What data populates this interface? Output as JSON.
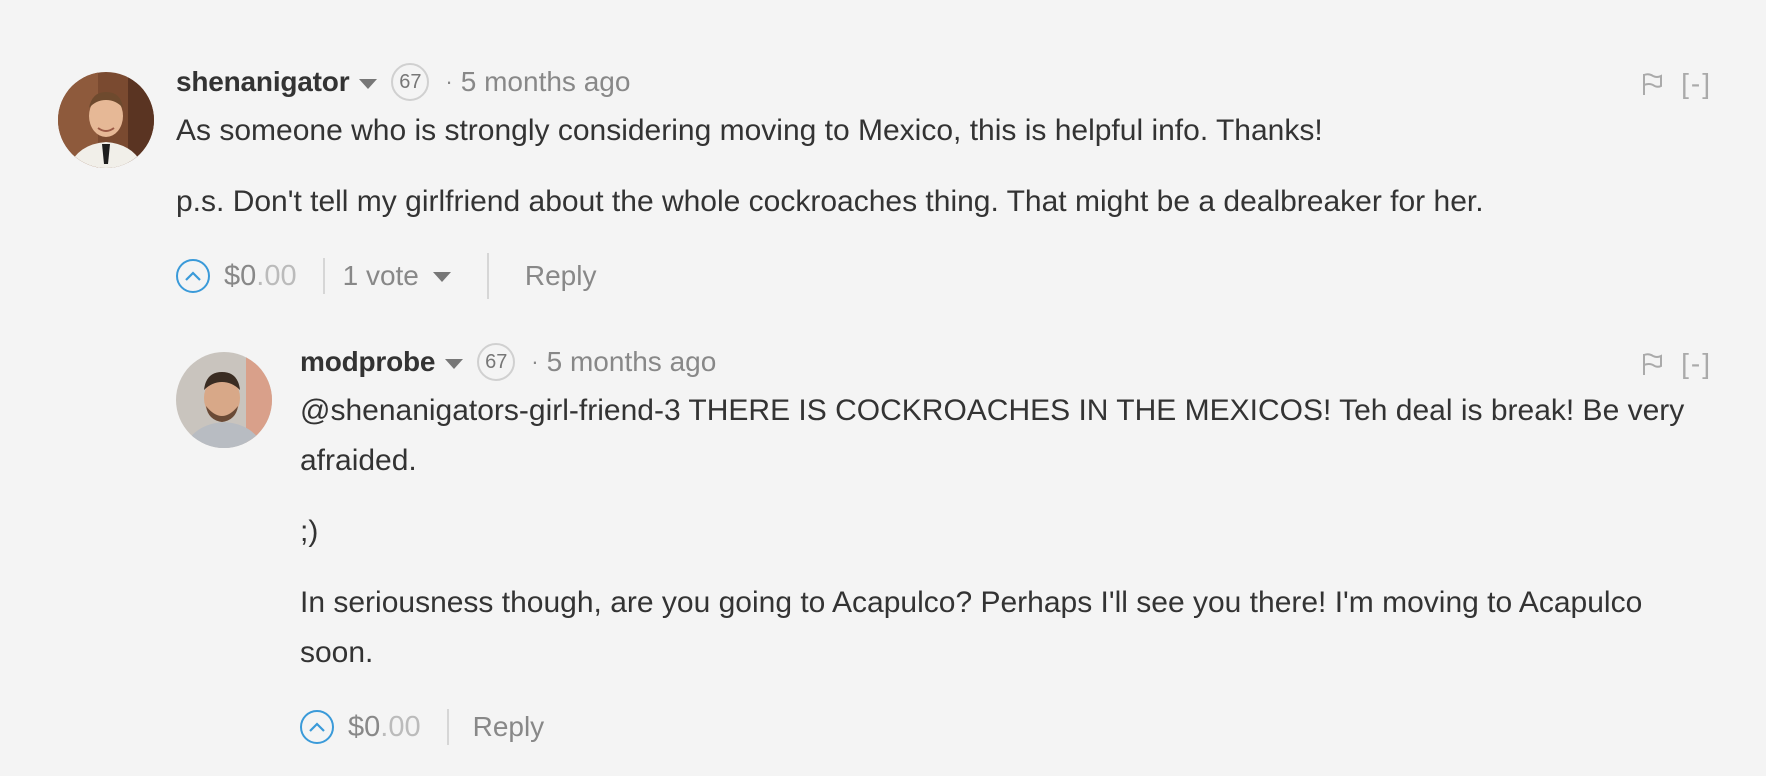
{
  "comments": [
    {
      "author": "shenanigator",
      "reputation": "67",
      "separator": "·",
      "timestamp": "5 months ago",
      "collapse_label": "[-]",
      "paragraphs": [
        "As someone who is strongly considering moving to Mexico, this is helpful info. Thanks!",
        "p.s. Don't tell my girlfriend about the whole cockroaches thing. That might be a dealbreaker for her."
      ],
      "payout_dollars": "$0",
      "payout_cents": ".00",
      "votes_label": "1 vote",
      "reply_label": "Reply"
    },
    {
      "author": "modprobe",
      "reputation": "67",
      "separator": "·",
      "timestamp": "5 months ago",
      "collapse_label": "[-]",
      "paragraphs": [
        "@shenanigators-girl-friend-3 THERE IS COCKROACHES IN THE MEXICOS! Teh deal is break! Be very afraided.",
        ";)",
        "In seriousness though, are you going to Acapulco? Perhaps I'll see you there! I'm moving to Acapulco soon."
      ],
      "payout_dollars": "$0",
      "payout_cents": ".00",
      "reply_label": "Reply"
    }
  ],
  "colors": {
    "upvote_accent": "#3a9ad9",
    "muted_text": "#888888",
    "body_text": "#333333"
  },
  "icons": {
    "upvote": "chevron-up-circle-icon",
    "flag": "flag-icon",
    "menu": "caret-down-icon"
  }
}
